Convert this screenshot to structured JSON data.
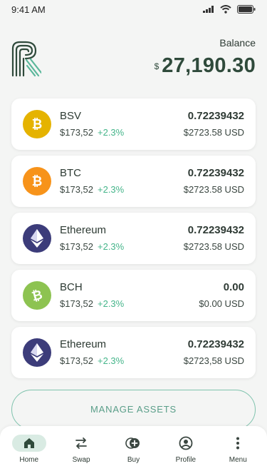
{
  "status_bar": {
    "time": "9:41 AM"
  },
  "header": {
    "balance_label": "Balance",
    "balance_currency": "$",
    "balance_value": "27,190.30"
  },
  "assets": [
    {
      "name": "BSV",
      "price": "$173,52",
      "change": "+2.3%",
      "amount": "0.72239432",
      "usd": "$2723.58 USD",
      "icon": "bitcoin-icon",
      "color": "#e5b300"
    },
    {
      "name": "BTC",
      "price": "$173,52",
      "change": "+2.3%",
      "amount": "0.72239432",
      "usd": "$2723.58 USD",
      "icon": "bitcoin-icon",
      "color": "#f7931a"
    },
    {
      "name": "Ethereum",
      "price": "$173,52",
      "change": "+2.3%",
      "amount": "0.72239432",
      "usd": "$2723.58 USD",
      "icon": "ethereum-icon",
      "color": "#3c3c7a"
    },
    {
      "name": "BCH",
      "price": "$173,52",
      "change": "+2.3%",
      "amount": "0.00",
      "usd": "$0.00 USD",
      "icon": "bitcoin-cash-icon",
      "color": "#8dc351"
    },
    {
      "name": "Ethereum",
      "price": "$173,52",
      "change": "+2.3%",
      "amount": "0.72239432",
      "usd": "$2723,58 USD",
      "icon": "ethereum-icon",
      "color": "#3c3c7a"
    }
  ],
  "manage_button": "MANAGE ASSETS",
  "nav": [
    {
      "label": "Home",
      "icon": "home-icon",
      "active": true
    },
    {
      "label": "Swap",
      "icon": "swap-icon",
      "active": false
    },
    {
      "label": "Buy",
      "icon": "buy-icon",
      "active": false
    },
    {
      "label": "Profile",
      "icon": "profile-icon",
      "active": false
    },
    {
      "label": "Menu",
      "icon": "more-vertical-icon",
      "active": false
    }
  ]
}
